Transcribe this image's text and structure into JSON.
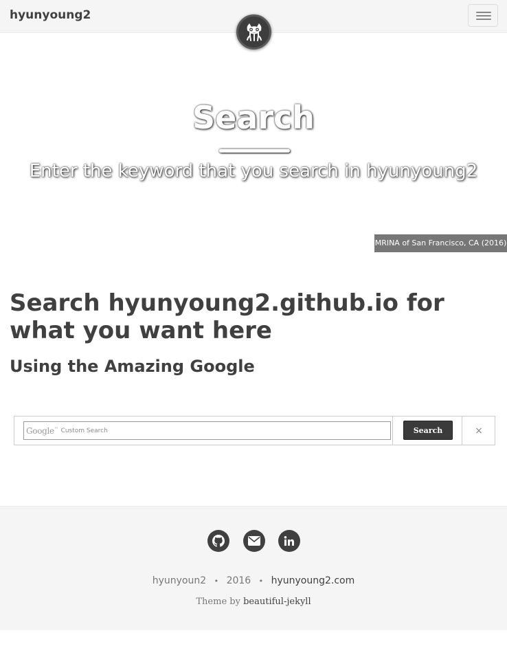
{
  "navbar": {
    "brand": "hyunyoung2",
    "menu_icon": "hamburger-menu-icon",
    "avatar_icon": "octocat-icon"
  },
  "header": {
    "title": "Search",
    "subtitle": "Enter the keyword that you search in hyunyoung2",
    "image_credit": "MRINA of San Francisco, CA (2016)"
  },
  "main": {
    "heading": "Search hyunyoung2.github.io for what you want here",
    "subheading": "Using the Amazing Google"
  },
  "search": {
    "logo_text": "Google",
    "logo_tm": "™",
    "placeholder": "Custom Search",
    "button_label": "Search",
    "clear_label": "×"
  },
  "footer": {
    "social": [
      {
        "name": "github",
        "icon": "github-icon"
      },
      {
        "name": "email",
        "icon": "envelope-icon"
      },
      {
        "name": "linkedin",
        "icon": "linkedin-icon"
      }
    ],
    "author": "hyunyoun2",
    "year": "2016",
    "site_link": "hyunyoung2.com",
    "theme_prefix": "Theme by",
    "theme_link": "beautiful-jekyll"
  },
  "colors": {
    "dark": "#404040",
    "footer_bg": "#f5f5f5",
    "credit_bg": "#777777"
  }
}
